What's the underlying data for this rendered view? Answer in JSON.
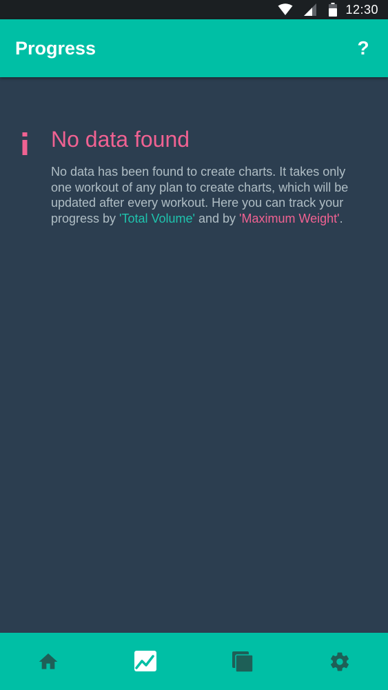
{
  "status_bar": {
    "time": "12:30",
    "icons": [
      "wifi-icon",
      "cell-signal-icon",
      "battery-icon"
    ]
  },
  "app_bar": {
    "title": "Progress",
    "help_label": "?"
  },
  "empty_state": {
    "icon": "info-icon",
    "title": "No data found",
    "description_parts": {
      "p1": "No data has been found to create charts. It takes only one workout of any plan to create charts, which will be updated after every workout. Here you can track your progress by ",
      "highlight1": "'Total Volume'",
      "p2": " and by ",
      "highlight2": "'Maximum Weight'",
      "p3": "."
    }
  },
  "bottom_nav": {
    "items": [
      {
        "icon": "home-icon",
        "selected": false
      },
      {
        "icon": "progress-chart-icon",
        "selected": true
      },
      {
        "icon": "plans-stack-icon",
        "selected": false
      },
      {
        "icon": "settings-gear-icon",
        "selected": false
      }
    ]
  },
  "colors": {
    "accent": "#00bfa5",
    "background": "#2c3e50",
    "status_bar": "#1b1f22",
    "pink": "#f06292",
    "teal_text": "#1fc3ad",
    "body_text": "#b0bec5",
    "nav_icon_inactive": "#1e5f57",
    "nav_icon_active": "#ffffff"
  }
}
